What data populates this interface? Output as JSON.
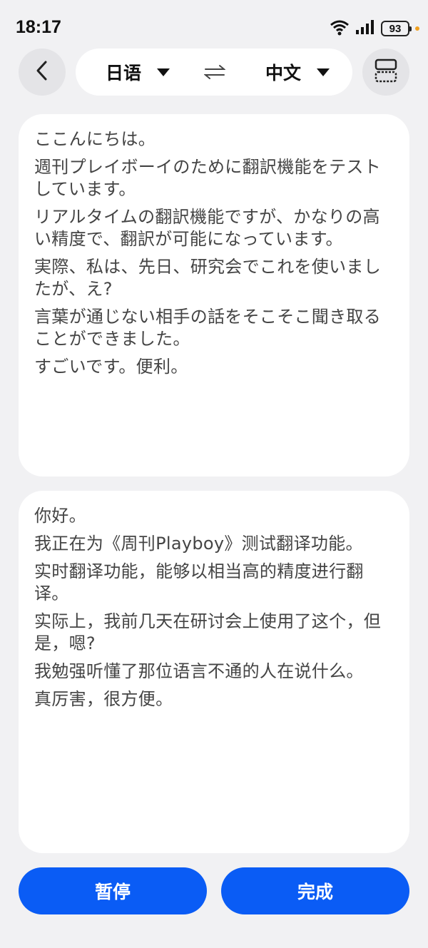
{
  "status_bar": {
    "time": "18:17",
    "battery_level": "93",
    "icons": [
      "wifi-icon",
      "signal-icon",
      "battery-icon"
    ]
  },
  "header": {
    "source_language": "日语",
    "target_language": "中文",
    "icons": [
      "back-arrow-icon",
      "swap-icon",
      "split-layout-icon"
    ]
  },
  "source_panel": {
    "paragraphs": [
      "ここんにちは。",
      "週刊プレイボーイのために翻訳機能をテストしています。",
      "リアルタイムの翻訳機能ですが、かなりの高い精度で、翻訳が可能になっています。",
      "実際、私は、先日、研究会でこれを使いましたが、え?",
      "言葉が通じない相手の話をそこそこ聞き取ることができました。",
      "すごいです。便利。"
    ]
  },
  "target_panel": {
    "paragraphs": [
      "你好。",
      "我正在为《周刊Playboy》测试翻译功能。",
      "实时翻译功能，能够以相当高的精度进行翻译。",
      "实际上，我前几天在研讨会上使用了这个，但是，嗯?",
      "我勉强听懂了那位语言不通的人在说什么。",
      "真厉害，很方便。"
    ]
  },
  "footer": {
    "pause_label": "暂停",
    "done_label": "完成"
  },
  "colors": {
    "accent": "#0a5cf5",
    "background": "#f1f1f3",
    "card": "#ffffff"
  }
}
